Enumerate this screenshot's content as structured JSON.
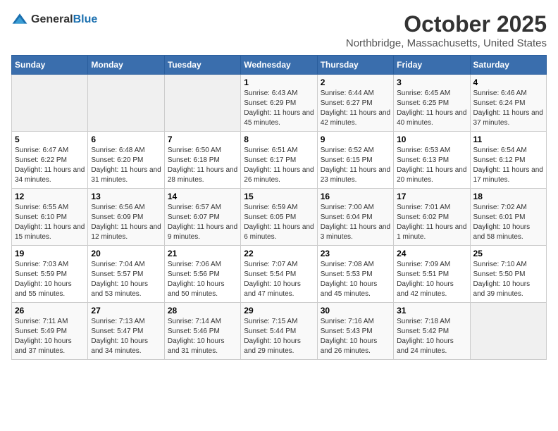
{
  "header": {
    "logo_general": "General",
    "logo_blue": "Blue",
    "month": "October 2025",
    "location": "Northbridge, Massachusetts, United States"
  },
  "columns": [
    "Sunday",
    "Monday",
    "Tuesday",
    "Wednesday",
    "Thursday",
    "Friday",
    "Saturday"
  ],
  "weeks": [
    {
      "days": [
        {
          "num": "",
          "sunrise": "",
          "sunset": "",
          "daylight": ""
        },
        {
          "num": "",
          "sunrise": "",
          "sunset": "",
          "daylight": ""
        },
        {
          "num": "",
          "sunrise": "",
          "sunset": "",
          "daylight": ""
        },
        {
          "num": "1",
          "sunrise": "Sunrise: 6:43 AM",
          "sunset": "Sunset: 6:29 PM",
          "daylight": "Daylight: 11 hours and 45 minutes."
        },
        {
          "num": "2",
          "sunrise": "Sunrise: 6:44 AM",
          "sunset": "Sunset: 6:27 PM",
          "daylight": "Daylight: 11 hours and 42 minutes."
        },
        {
          "num": "3",
          "sunrise": "Sunrise: 6:45 AM",
          "sunset": "Sunset: 6:25 PM",
          "daylight": "Daylight: 11 hours and 40 minutes."
        },
        {
          "num": "4",
          "sunrise": "Sunrise: 6:46 AM",
          "sunset": "Sunset: 6:24 PM",
          "daylight": "Daylight: 11 hours and 37 minutes."
        }
      ]
    },
    {
      "days": [
        {
          "num": "5",
          "sunrise": "Sunrise: 6:47 AM",
          "sunset": "Sunset: 6:22 PM",
          "daylight": "Daylight: 11 hours and 34 minutes."
        },
        {
          "num": "6",
          "sunrise": "Sunrise: 6:48 AM",
          "sunset": "Sunset: 6:20 PM",
          "daylight": "Daylight: 11 hours and 31 minutes."
        },
        {
          "num": "7",
          "sunrise": "Sunrise: 6:50 AM",
          "sunset": "Sunset: 6:18 PM",
          "daylight": "Daylight: 11 hours and 28 minutes."
        },
        {
          "num": "8",
          "sunrise": "Sunrise: 6:51 AM",
          "sunset": "Sunset: 6:17 PM",
          "daylight": "Daylight: 11 hours and 26 minutes."
        },
        {
          "num": "9",
          "sunrise": "Sunrise: 6:52 AM",
          "sunset": "Sunset: 6:15 PM",
          "daylight": "Daylight: 11 hours and 23 minutes."
        },
        {
          "num": "10",
          "sunrise": "Sunrise: 6:53 AM",
          "sunset": "Sunset: 6:13 PM",
          "daylight": "Daylight: 11 hours and 20 minutes."
        },
        {
          "num": "11",
          "sunrise": "Sunrise: 6:54 AM",
          "sunset": "Sunset: 6:12 PM",
          "daylight": "Daylight: 11 hours and 17 minutes."
        }
      ]
    },
    {
      "days": [
        {
          "num": "12",
          "sunrise": "Sunrise: 6:55 AM",
          "sunset": "Sunset: 6:10 PM",
          "daylight": "Daylight: 11 hours and 15 minutes."
        },
        {
          "num": "13",
          "sunrise": "Sunrise: 6:56 AM",
          "sunset": "Sunset: 6:09 PM",
          "daylight": "Daylight: 11 hours and 12 minutes."
        },
        {
          "num": "14",
          "sunrise": "Sunrise: 6:57 AM",
          "sunset": "Sunset: 6:07 PM",
          "daylight": "Daylight: 11 hours and 9 minutes."
        },
        {
          "num": "15",
          "sunrise": "Sunrise: 6:59 AM",
          "sunset": "Sunset: 6:05 PM",
          "daylight": "Daylight: 11 hours and 6 minutes."
        },
        {
          "num": "16",
          "sunrise": "Sunrise: 7:00 AM",
          "sunset": "Sunset: 6:04 PM",
          "daylight": "Daylight: 11 hours and 3 minutes."
        },
        {
          "num": "17",
          "sunrise": "Sunrise: 7:01 AM",
          "sunset": "Sunset: 6:02 PM",
          "daylight": "Daylight: 11 hours and 1 minute."
        },
        {
          "num": "18",
          "sunrise": "Sunrise: 7:02 AM",
          "sunset": "Sunset: 6:01 PM",
          "daylight": "Daylight: 10 hours and 58 minutes."
        }
      ]
    },
    {
      "days": [
        {
          "num": "19",
          "sunrise": "Sunrise: 7:03 AM",
          "sunset": "Sunset: 5:59 PM",
          "daylight": "Daylight: 10 hours and 55 minutes."
        },
        {
          "num": "20",
          "sunrise": "Sunrise: 7:04 AM",
          "sunset": "Sunset: 5:57 PM",
          "daylight": "Daylight: 10 hours and 53 minutes."
        },
        {
          "num": "21",
          "sunrise": "Sunrise: 7:06 AM",
          "sunset": "Sunset: 5:56 PM",
          "daylight": "Daylight: 10 hours and 50 minutes."
        },
        {
          "num": "22",
          "sunrise": "Sunrise: 7:07 AM",
          "sunset": "Sunset: 5:54 PM",
          "daylight": "Daylight: 10 hours and 47 minutes."
        },
        {
          "num": "23",
          "sunrise": "Sunrise: 7:08 AM",
          "sunset": "Sunset: 5:53 PM",
          "daylight": "Daylight: 10 hours and 45 minutes."
        },
        {
          "num": "24",
          "sunrise": "Sunrise: 7:09 AM",
          "sunset": "Sunset: 5:51 PM",
          "daylight": "Daylight: 10 hours and 42 minutes."
        },
        {
          "num": "25",
          "sunrise": "Sunrise: 7:10 AM",
          "sunset": "Sunset: 5:50 PM",
          "daylight": "Daylight: 10 hours and 39 minutes."
        }
      ]
    },
    {
      "days": [
        {
          "num": "26",
          "sunrise": "Sunrise: 7:11 AM",
          "sunset": "Sunset: 5:49 PM",
          "daylight": "Daylight: 10 hours and 37 minutes."
        },
        {
          "num": "27",
          "sunrise": "Sunrise: 7:13 AM",
          "sunset": "Sunset: 5:47 PM",
          "daylight": "Daylight: 10 hours and 34 minutes."
        },
        {
          "num": "28",
          "sunrise": "Sunrise: 7:14 AM",
          "sunset": "Sunset: 5:46 PM",
          "daylight": "Daylight: 10 hours and 31 minutes."
        },
        {
          "num": "29",
          "sunrise": "Sunrise: 7:15 AM",
          "sunset": "Sunset: 5:44 PM",
          "daylight": "Daylight: 10 hours and 29 minutes."
        },
        {
          "num": "30",
          "sunrise": "Sunrise: 7:16 AM",
          "sunset": "Sunset: 5:43 PM",
          "daylight": "Daylight: 10 hours and 26 minutes."
        },
        {
          "num": "31",
          "sunrise": "Sunrise: 7:18 AM",
          "sunset": "Sunset: 5:42 PM",
          "daylight": "Daylight: 10 hours and 24 minutes."
        },
        {
          "num": "",
          "sunrise": "",
          "sunset": "",
          "daylight": ""
        }
      ]
    }
  ]
}
